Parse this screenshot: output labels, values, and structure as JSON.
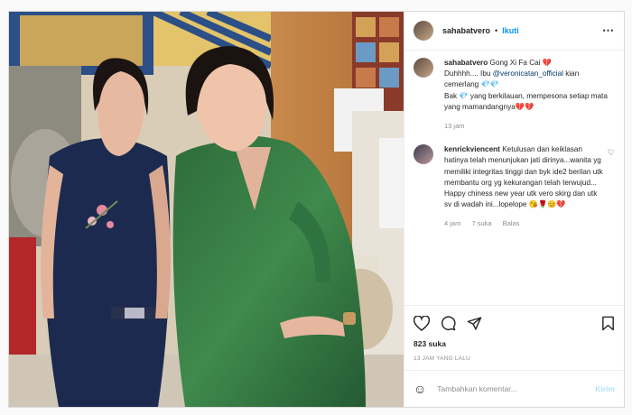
{
  "header": {
    "username": "sahabatvero",
    "separator": "•",
    "follow_label": "Ikuti"
  },
  "caption": {
    "username": "sahabatvero",
    "line1": "Gong Xi Fa Cai ",
    "line1_emoji": "💔",
    "line2_a": "Duhhhh.... Ibu ",
    "mention": "@veronicatan_official",
    "line2_b": " kian cemerlang ",
    "line2_emoji": "💎💎",
    "line3_a": "Bak ",
    "line3_emoji": "💎",
    "line3_b": " yang berkilauan, mempesona setiap mata yang mamandangnya",
    "line3_end": "💔💔",
    "time": "13 jam"
  },
  "comment": {
    "username": "kenrickviencent",
    "text": "Ketulusan dan keiklasan hatinya telah menunjukan jati dirinya...wanita yg memiliki integritas tinggi dan byk ide2 berilan utk membantu org yg kekurangan telah terwujud... Happy chiness new year utk vero skirg dan utk sv di wadah ini...lopelope ",
    "emojis": "😘🌹😊💔",
    "time": "4 jam",
    "likes": "7 suka",
    "reply": "Balas",
    "heart_icon": "heart-outline-icon"
  },
  "actions": {
    "likes": "823 suka",
    "time_ago": "13 JAM YANG LALU"
  },
  "add_comment": {
    "placeholder": "Tambahkan komentar...",
    "send_label": "Kirim"
  },
  "colors": {
    "link": "#0095f6",
    "muted": "#8e8e8e",
    "border": "#dbdbdb"
  }
}
